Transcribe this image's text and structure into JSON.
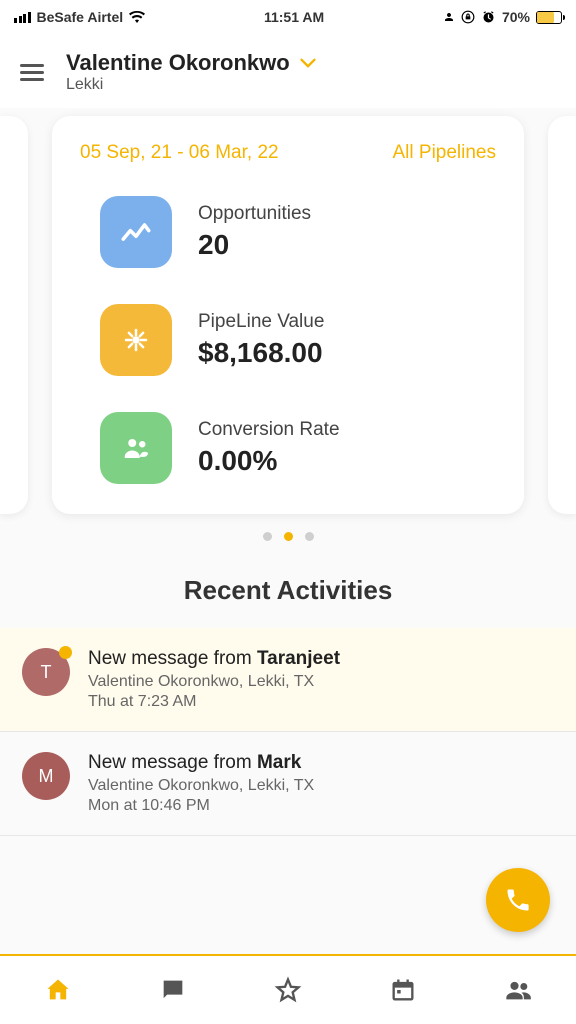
{
  "status_bar": {
    "carrier": "BeSafe Airtel",
    "time": "11:51 AM",
    "battery_percent": "70%"
  },
  "header": {
    "name": "Valentine Okoronkwo",
    "location": "Lekki"
  },
  "card": {
    "date_range": "05 Sep, 21 - 06 Mar, 22",
    "pipelines_label": "All Pipelines",
    "metrics": [
      {
        "label": "Opportunities",
        "value": "20"
      },
      {
        "label": "PipeLine Value",
        "value": "$8,168.00"
      },
      {
        "label": "Conversion Rate",
        "value": "0.00%"
      }
    ]
  },
  "section_title": "Recent Activities",
  "activities": [
    {
      "avatar_letter": "T",
      "title_prefix": "New message from ",
      "title_bold": "Taranjeet",
      "sub": "Valentine Okoronkwo, Lekki, TX",
      "time": "Thu at 7:23 AM",
      "unread": true
    },
    {
      "avatar_letter": "M",
      "title_prefix": "New message from ",
      "title_bold": "Mark",
      "sub": "Valentine Okoronkwo, Lekki, TX",
      "time": "Mon at 10:46 PM",
      "unread": false
    }
  ]
}
